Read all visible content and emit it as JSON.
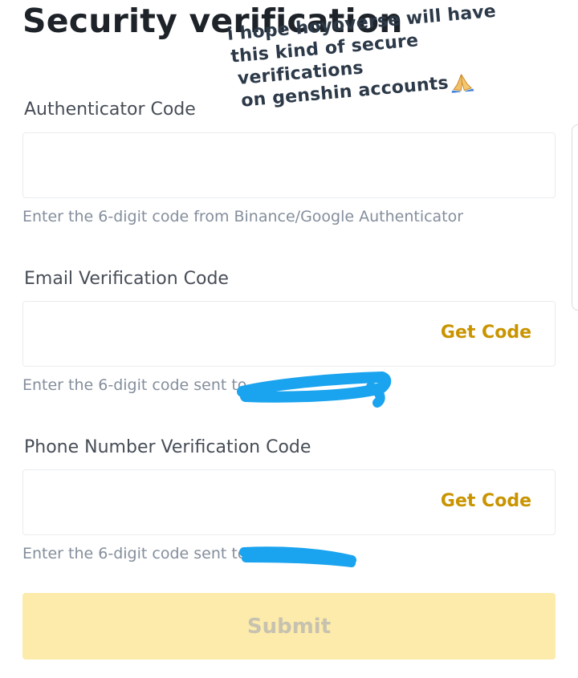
{
  "page": {
    "title": "Security verification"
  },
  "overlay_text": {
    "lines": [
      "i hope hoyoverse will have",
      "this kind of secure",
      "verifications",
      "on genshin accounts"
    ],
    "emoji": "folded-hands"
  },
  "form": {
    "authenticator": {
      "label": "Authenticator Code",
      "value": "",
      "hint": "Enter the 6-digit code from Binance/Google Authenticator"
    },
    "email": {
      "label": "Email Verification Code",
      "value": "",
      "action": "Get Code",
      "hint_prefix": "Enter the 6-digit code sent to"
    },
    "phone": {
      "label": "Phone Number Verification Code",
      "value": "",
      "action": "Get Code",
      "hint_prefix": "Enter the 6-digit code sent to"
    },
    "submit_label": "Submit"
  },
  "colors": {
    "accent": "#c99400",
    "submit_bg": "#fcebaa",
    "redaction": "#1aa3ee",
    "hint": "#848e9c"
  }
}
